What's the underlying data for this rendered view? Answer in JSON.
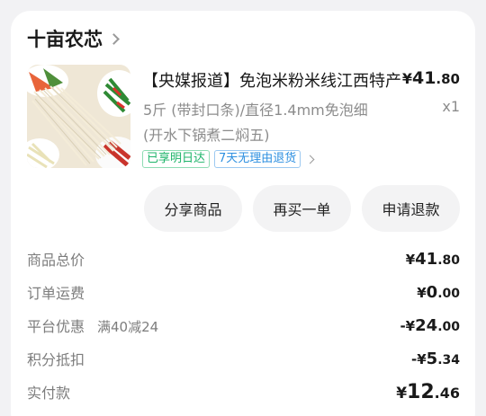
{
  "shop": {
    "name": "十亩农芯"
  },
  "item": {
    "title": "【央媒报道】免泡米粉米线江西特产",
    "spec": "5斤 (带封口条)/直径1.4mm免泡细 (开水下锅煮二焖五)",
    "qty": "x1",
    "price": {
      "symbol": "¥",
      "int": "41",
      "dec": ".80"
    },
    "tags": [
      "已享明日达",
      "7天无理由退货"
    ]
  },
  "actions": [
    "分享商品",
    "再买一单",
    "申请退款"
  ],
  "summary": [
    {
      "label": "商品总价",
      "symbol": "¥",
      "int": "41",
      "dec": ".80"
    },
    {
      "label": "订单运费",
      "symbol": "¥",
      "int": "0",
      "dec": ".00"
    },
    {
      "label": "平台优惠",
      "promo": "满40减24",
      "symbol": "-¥",
      "int": "24",
      "dec": ".00"
    },
    {
      "label": "积分抵扣",
      "symbol": "-¥",
      "int": "5",
      "dec": ".34"
    },
    {
      "label": "实付款",
      "symbol": "¥",
      "int": "12",
      "dec": ".46"
    }
  ],
  "colors": {
    "tag_green": "#1eb46a",
    "tag_blue": "#2d8fe0",
    "background": "#f2f2f4"
  }
}
